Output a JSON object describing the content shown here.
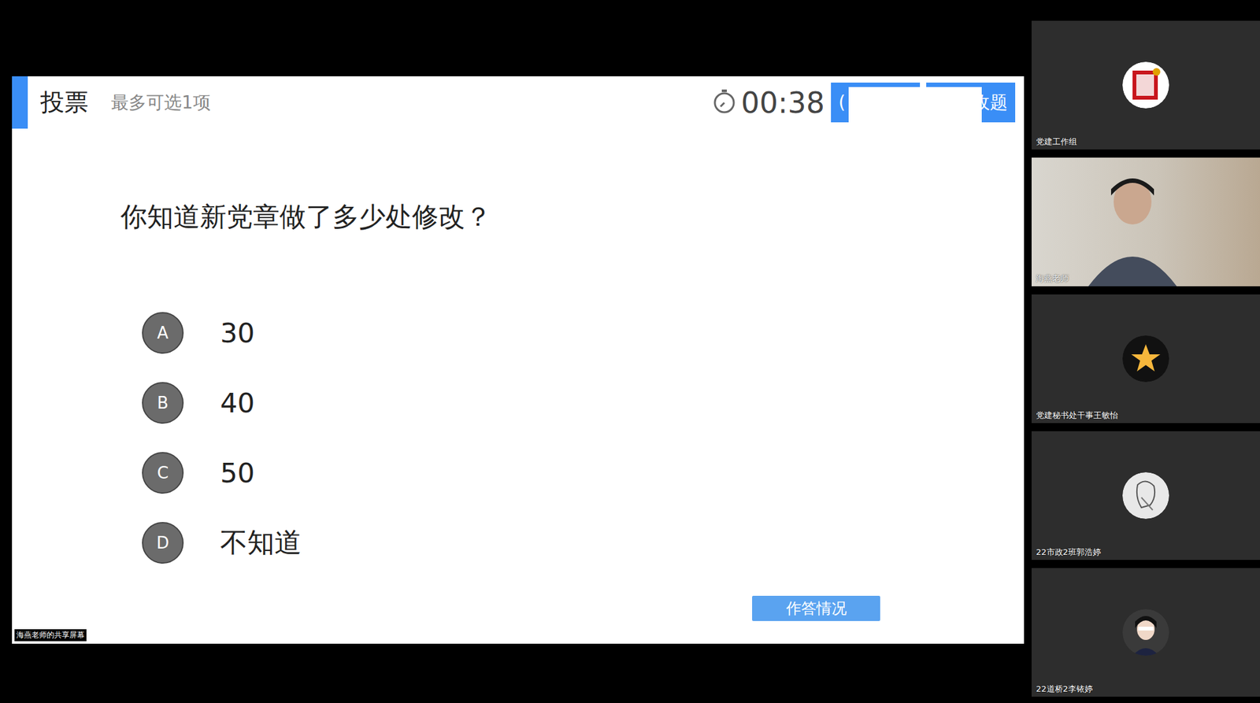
{
  "vote": {
    "title": "投票",
    "hint": "最多可选1项",
    "timer": "00:38",
    "buttons": [
      {
        "label": "("
      },
      {
        "label": "收题"
      }
    ],
    "question": "你知道新党章做了多少处修改？",
    "options": [
      {
        "letter": "A",
        "text": "30"
      },
      {
        "letter": "B",
        "text": "40"
      },
      {
        "letter": "C",
        "text": "50"
      },
      {
        "letter": "D",
        "text": "不知道"
      }
    ],
    "answers_button": "作答情况",
    "share_label": "海燕老师的共享屏幕"
  },
  "participants": [
    {
      "name": "党建工作组",
      "kind": "logo"
    },
    {
      "name": "海燕老师",
      "kind": "video"
    },
    {
      "name": "党建秘书处干事王敏怡",
      "kind": "star"
    },
    {
      "name": "22市政2班郭浩婷",
      "kind": "sketch"
    },
    {
      "name": "22道桥2李铱婷",
      "kind": "photo"
    }
  ]
}
